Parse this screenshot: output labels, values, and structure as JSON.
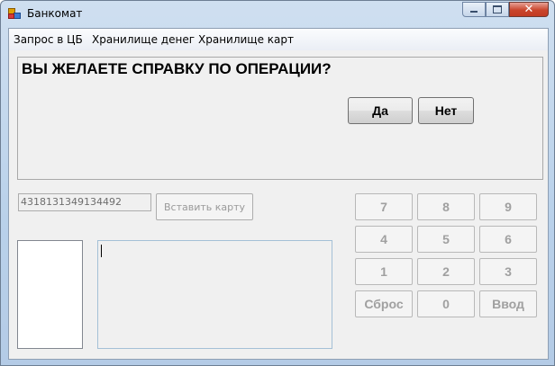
{
  "window": {
    "title": "Банкомат",
    "close_glyph": "✕"
  },
  "menu": {
    "items": [
      "Запрос в ЦБ",
      "Хранилище денег",
      "Хранилище карт"
    ]
  },
  "dialog": {
    "question": "ВЫ ЖЕЛАЕТЕ СПРАВКУ ПО ОПЕРАЦИИ?",
    "yes_label": "Да",
    "no_label": "Нет"
  },
  "card": {
    "number": "4318131349134492",
    "insert_label": "Вставить карту"
  },
  "keypad": {
    "keys": [
      "7",
      "8",
      "9",
      "4",
      "5",
      "6",
      "1",
      "2",
      "3",
      "Сброс",
      "0",
      "Ввод"
    ]
  },
  "colors": {
    "disabled_text": "#a0a0a0",
    "window_frame": "#b9d1ea"
  }
}
